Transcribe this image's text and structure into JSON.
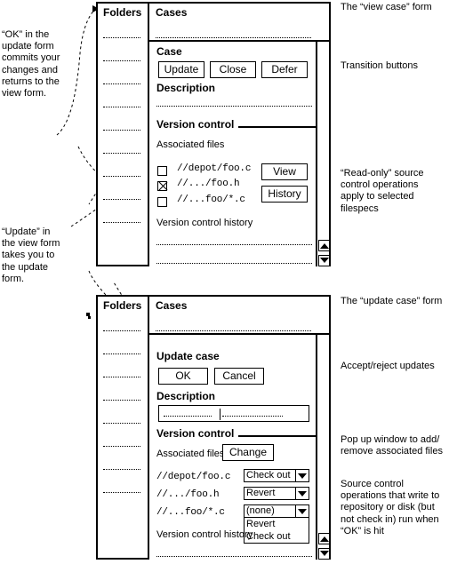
{
  "annotations": {
    "left": [
      {
        "id": "ok-note",
        "text": "“OK” in the\nupdate form\ncommits your\nchanges and\nreturns to the\nview form."
      },
      {
        "id": "update-note",
        "text": "“Update” in\nthe view form\ntakes you to\nthe update\nform."
      }
    ],
    "right": [
      {
        "id": "view-case-form",
        "text": "The “view case” form"
      },
      {
        "id": "transition-buttons",
        "text": "Transition buttons"
      },
      {
        "id": "readonly-ops",
        "text": "“Read-only” source\ncontrol operations\napply to selected\nfilespecs"
      },
      {
        "id": "update-case-form",
        "text": "The “update case” form"
      },
      {
        "id": "accept-reject",
        "text": "Accept/reject updates"
      },
      {
        "id": "popup-window",
        "text": "Pop up window to add/\nremove associated files"
      },
      {
        "id": "write-ops",
        "text": "Source control\noperations that write to\nrepository or disk (but\nnot check in) run when\n“OK” is hit"
      }
    ]
  },
  "view_form": {
    "folders_header": "Folders",
    "cases_header": "Cases",
    "folder_row_count": 9,
    "panel_title": "Case",
    "buttons": [
      {
        "label": "Update"
      },
      {
        "label": "Close"
      },
      {
        "label": "Defer"
      }
    ],
    "description_title": "Description",
    "version_control_title": "Version control",
    "associated_files_label": "Associated files",
    "files": [
      {
        "path": "//depot/foo.c",
        "checked": false
      },
      {
        "path": "//.../foo.h",
        "checked": true
      },
      {
        "path": "//...foo/*.c",
        "checked": false
      }
    ],
    "side_buttons": [
      {
        "label": "View"
      },
      {
        "label": "History"
      }
    ],
    "history_label": "Version control history"
  },
  "update_form": {
    "folders_header": "Folders",
    "cases_header": "Cases",
    "folder_row_count": 8,
    "panel_title": "Update case",
    "buttons": [
      {
        "label": "OK"
      },
      {
        "label": "Cancel"
      }
    ],
    "description_title": "Description",
    "description_value": "",
    "description_placeholder": "",
    "version_control_title": "Version control",
    "associated_files_label": "Associated files",
    "change_button": "Change",
    "files": [
      {
        "path": "//depot/foo.c",
        "action": "Check out"
      },
      {
        "path": "//.../foo.h",
        "action": "Revert"
      },
      {
        "path": "//...foo/*.c",
        "action": "(none)"
      }
    ],
    "open_dropdown_options": [
      "Revert",
      "Check out"
    ],
    "history_label": "Version control history"
  },
  "icons": {
    "scroll_up": "scroll-up-arrow",
    "scroll_down": "scroll-down-arrow",
    "dropdown": "chevron-down-icon",
    "checkbox_checked": "checkbox-checked-icon",
    "checkbox_unchecked": "checkbox-unchecked-icon"
  },
  "colors": {
    "ink": "#000000",
    "paper": "#ffffff"
  }
}
